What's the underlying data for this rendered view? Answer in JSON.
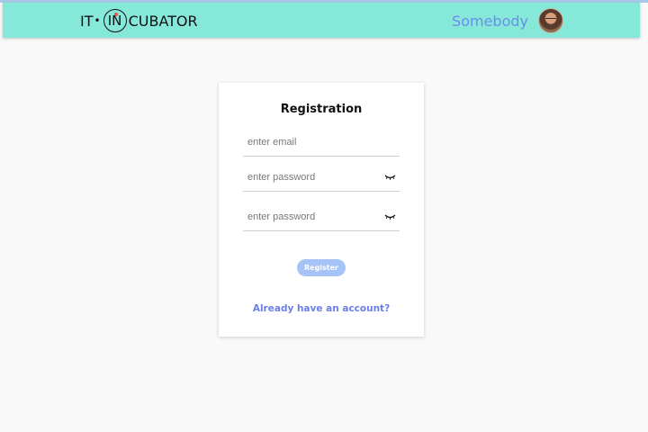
{
  "header": {
    "logo": {
      "left": "IT",
      "separator": "•",
      "circle": "IN",
      "right": "CUBATOR"
    },
    "user_name": "Somebody",
    "avatar_icon": "user-avatar"
  },
  "form": {
    "title": "Registration",
    "email_placeholder": "enter email",
    "password_placeholder": "enter password",
    "confirm_placeholder": "enter password",
    "password_toggle_icon": "eye-closed-icon",
    "register_label": "Register",
    "login_link": "Already have an account?"
  },
  "colors": {
    "header_bg": "#86e8d9",
    "accent": "#6b8cf0",
    "button_bg": "#a6c3f7"
  }
}
